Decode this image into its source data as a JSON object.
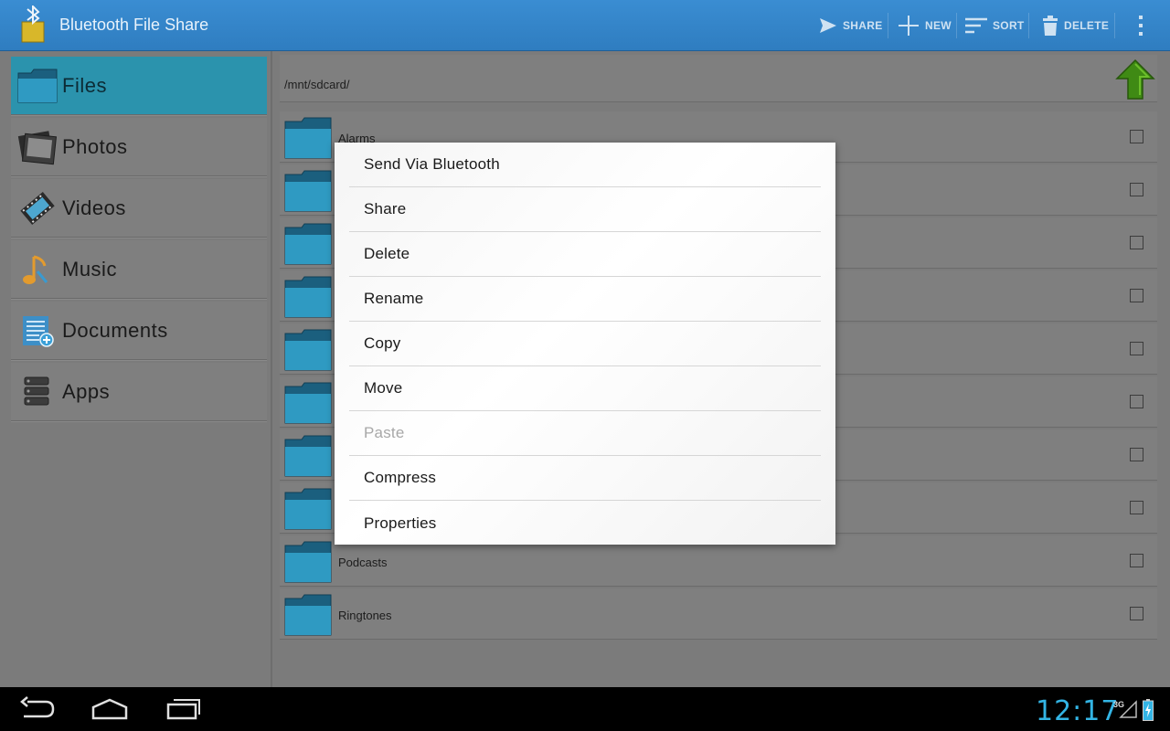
{
  "app": {
    "title": "Bluetooth File Share",
    "icon": "bluetooth-folder-icon"
  },
  "actionbar": {
    "share_label": "SHARE",
    "new_label": "NEW",
    "sort_label": "SORT",
    "delete_label": "DELETE"
  },
  "sidebar": {
    "items": [
      {
        "label": "Files",
        "icon": "folder-icon",
        "active": true
      },
      {
        "label": "Photos",
        "icon": "photos-icon"
      },
      {
        "label": "Videos",
        "icon": "film-icon"
      },
      {
        "label": "Music",
        "icon": "music-note-icon"
      },
      {
        "label": "Documents",
        "icon": "document-icon"
      },
      {
        "label": "Apps",
        "icon": "apps-icon"
      }
    ]
  },
  "path": "/mnt/sdcard/",
  "files": [
    {
      "name": "Alarms"
    },
    {
      "name": ""
    },
    {
      "name": ""
    },
    {
      "name": ""
    },
    {
      "name": ""
    },
    {
      "name": ""
    },
    {
      "name": ""
    },
    {
      "name": ""
    },
    {
      "name": "Podcasts"
    },
    {
      "name": "Ringtones"
    }
  ],
  "context_menu": {
    "items": [
      {
        "label": "Send Via Bluetooth",
        "enabled": true
      },
      {
        "label": "Share",
        "enabled": true
      },
      {
        "label": "Delete",
        "enabled": true
      },
      {
        "label": "Rename",
        "enabled": true
      },
      {
        "label": "Copy",
        "enabled": true
      },
      {
        "label": "Move",
        "enabled": true
      },
      {
        "label": "Paste",
        "enabled": false
      },
      {
        "label": "Compress",
        "enabled": true
      },
      {
        "label": "Properties",
        "enabled": true
      }
    ]
  },
  "statusbar": {
    "time": "12:17",
    "network": "3G"
  },
  "colors": {
    "accent": "#33b5e5",
    "actionbar": "#3a8dd2",
    "active_nav": "#2b93ad"
  }
}
